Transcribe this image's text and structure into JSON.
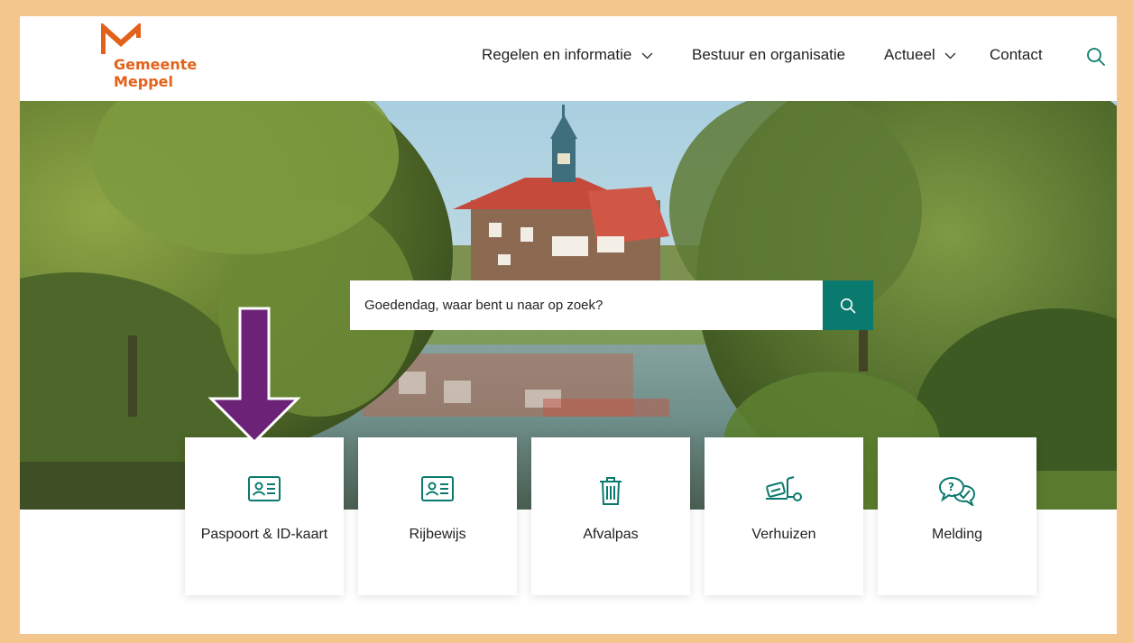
{
  "logo": {
    "line1": "Gemeente",
    "line2": "Meppel"
  },
  "nav": {
    "items": [
      {
        "label": "Regelen en informatie",
        "dropdown": true
      },
      {
        "label": "Bestuur en organisatie",
        "dropdown": false
      },
      {
        "label": "Actueel",
        "dropdown": true
      },
      {
        "label": "Contact",
        "dropdown": false
      }
    ],
    "search_icon": "search-icon"
  },
  "search": {
    "placeholder": "Goedendag, waar bent u naar op zoek?",
    "button_icon": "search-icon"
  },
  "tiles": [
    {
      "label": "Paspoort & ID-kaart",
      "icon": "id-card-icon"
    },
    {
      "label": "Rijbewijs",
      "icon": "id-card-icon"
    },
    {
      "label": "Afvalpas",
      "icon": "trash-bin-icon"
    },
    {
      "label": "Verhuizen",
      "icon": "hand-truck-icon"
    },
    {
      "label": "Melding",
      "icon": "chat-question-icon"
    }
  ],
  "colors": {
    "brand_orange": "#e2621b",
    "accent_teal": "#0b7a6e",
    "annotation_purple": "#6b2277",
    "frame_border": "#f3c68e"
  }
}
